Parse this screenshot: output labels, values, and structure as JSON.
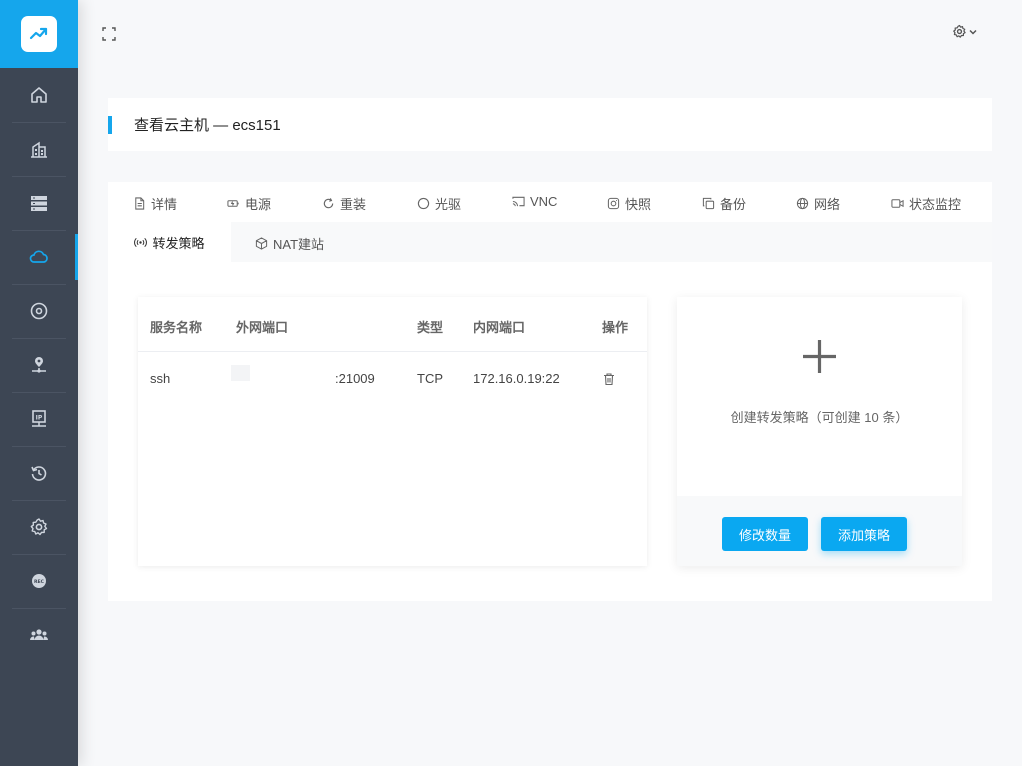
{
  "sidebar": {
    "items": [
      {
        "icon": "home-icon"
      },
      {
        "icon": "building-icon"
      },
      {
        "icon": "server-icon"
      },
      {
        "icon": "cloud-icon",
        "active": true
      },
      {
        "icon": "disk-icon"
      },
      {
        "icon": "network-location-icon"
      },
      {
        "icon": "ip-icon"
      },
      {
        "icon": "restore-icon"
      },
      {
        "icon": "gear-icon"
      },
      {
        "icon": "rec-icon"
      },
      {
        "icon": "users-icon"
      }
    ]
  },
  "header": {
    "title": "查看云主机 — ecs151"
  },
  "tabs": [
    {
      "label": "详情",
      "icon": "document-icon"
    },
    {
      "label": "电源",
      "icon": "power-icon"
    },
    {
      "label": "重装",
      "icon": "refresh-icon"
    },
    {
      "label": "光驱",
      "icon": "circle-icon"
    },
    {
      "label": "VNC",
      "icon": "cast-icon"
    },
    {
      "label": "快照",
      "icon": "camera-icon"
    },
    {
      "label": "备份",
      "icon": "copy-icon"
    },
    {
      "label": "网络",
      "icon": "globe-icon"
    },
    {
      "label": "状态监控",
      "icon": "video-icon"
    },
    {
      "label": "转发策略",
      "icon": "broadcast-icon",
      "active": true
    },
    {
      "label": "NAT建站",
      "icon": "cube-icon"
    }
  ],
  "table": {
    "columns": [
      "服务名称",
      "外网端口",
      "类型",
      "内网端口",
      "操作"
    ],
    "rows": [
      {
        "name": "ssh",
        "external_port": ":21009",
        "type": "TCP",
        "internal": "172.16.0.19:22"
      }
    ]
  },
  "create": {
    "text": "创建转发策略（可创建 10 条）",
    "modify_button": "修改数量",
    "add_button": "添加策略"
  },
  "colors": {
    "accent": "#15a6ec",
    "button": "#0aa8f1",
    "sidebar": "#3d4654"
  }
}
